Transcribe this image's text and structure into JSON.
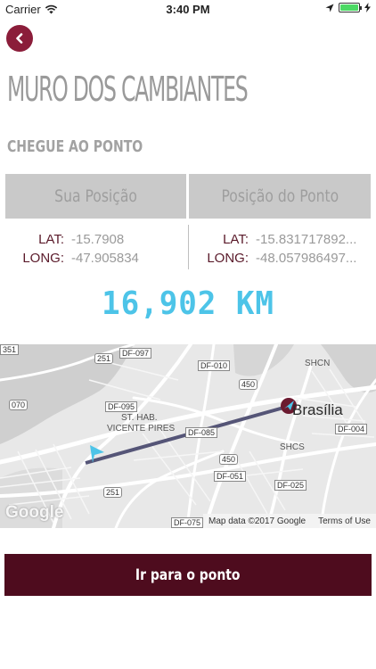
{
  "status_bar": {
    "carrier": "Carrier",
    "time": "3:40 PM"
  },
  "header": {
    "title": "MURO DOS CAMBIANTES",
    "subtitle": "CHEGUE AO PONTO"
  },
  "columns": {
    "left_header": "Sua Posição",
    "right_header": "Posição do Ponto"
  },
  "your_position": {
    "lat_label": "LAT:",
    "lat_value": "-15.7908",
    "long_label": "LONG:",
    "long_value": "-47.905834"
  },
  "point_position": {
    "lat_label": "LAT:",
    "lat_value": "-15.831717892...",
    "long_label": "LONG:",
    "long_value": "-48.057986497..."
  },
  "distance": "16,902 KM",
  "map": {
    "labels": {
      "city": "Brasília",
      "district": "ST. HAB.",
      "district2": "VICENTE PIRES",
      "shcn": "SHCN",
      "shcs": "SHCS",
      "google": "Google",
      "map_data": "Map data ©2017 Google",
      "terms": "Terms of Use"
    },
    "shields": {
      "r351": "351",
      "r251a": "251",
      "r251b": "251",
      "r070": "070",
      "r450a": "450",
      "r450b": "450",
      "df097": "DF-097",
      "df010": "DF-010",
      "df095": "DF-095",
      "df085": "DF-085",
      "df004": "DF-004",
      "df051": "DF-051",
      "df025": "DF-025",
      "df075": "DF-075"
    },
    "route_color": "#555577",
    "accent": "#4dc4e8"
  },
  "action_button": "Ir para o ponto",
  "colors": {
    "brand": "#4e0c1e",
    "back_button": "#8b1d3a",
    "distance": "#4dc4e8"
  }
}
